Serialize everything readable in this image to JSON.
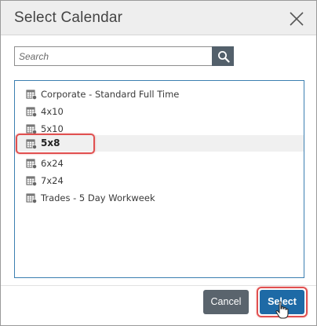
{
  "dialog": {
    "title": "Select Calendar",
    "close_icon": "close-icon"
  },
  "search": {
    "placeholder": "Search",
    "value": "",
    "icon": "search-icon"
  },
  "calendars": [
    {
      "label": "Corporate - Standard Full Time",
      "icon": "calendar-grid-icon",
      "selected": false
    },
    {
      "label": "4x10",
      "icon": "calendar-grid-icon",
      "selected": false
    },
    {
      "label": "5x10",
      "icon": "calendar-grid-icon",
      "selected": false
    },
    {
      "label": "5x8",
      "icon": "calendar-grid-icon",
      "selected": true
    },
    {
      "label": "6x24",
      "icon": "calendar-grid-icon",
      "selected": false
    },
    {
      "label": "7x24",
      "icon": "calendar-grid-icon",
      "selected": false
    },
    {
      "label": "Trades - 5 Day Workweek",
      "icon": "calendar-grid-icon",
      "selected": false
    }
  ],
  "buttons": {
    "cancel_label": "Cancel",
    "select_label": "Select"
  },
  "colors": {
    "primary": "#1e6aa6",
    "secondary": "#5a646d",
    "highlight": "#e05050",
    "list_border": "#3c7fb1"
  }
}
